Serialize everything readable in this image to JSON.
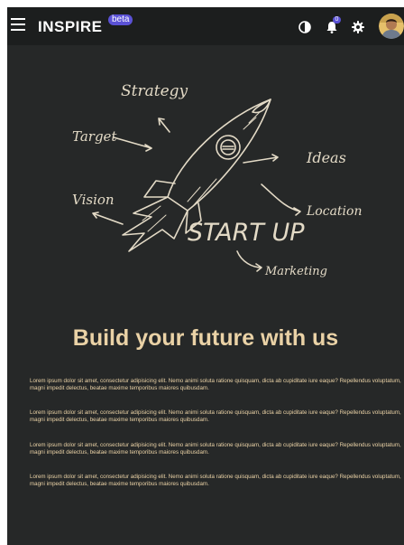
{
  "header": {
    "brand": "INSPIRE",
    "badge": "beta",
    "notification_count": "0"
  },
  "hero": {
    "art_labels": {
      "strategy": "Strategy",
      "target": "Target",
      "vision": "Vision",
      "ideas": "Ideas",
      "location": "Location",
      "startup": "START UP",
      "marketing": "Marketing"
    },
    "title": "Build your future with us"
  },
  "paragraphs": [
    "Lorem ipsum dolor sit amet, consectetur adipisicing elit. Nemo animi soluta ratione quisquam, dicta ab cupiditate iure eaque? Repellendus voluptatum, magni impedit delectus, beatae maxime temporibus maiores quibusdam.",
    "Lorem ipsum dolor sit amet, consectetur adipisicing elit. Nemo animi soluta ratione quisquam, dicta ab cupiditate iure eaque? Repellendus voluptatum, magni impedit delectus, beatae maxime temporibus maiores quibusdam.",
    "Lorem ipsum dolor sit amet, consectetur adipisicing elit. Nemo animi soluta ratione quisquam, dicta ab cupiditate iure eaque? Repellendus voluptatum, magni impedit delectus, beatae maxime temporibus maiores quibusdam.",
    "Lorem ipsum dolor sit amet, consectetur adipisicing elit. Nemo animi soluta ratione quisquam, dicta ab cupiditate iure eaque? Repellendus voluptatum, magni impedit delectus, beatae maxime temporibus maiores quibusdam."
  ],
  "colors": {
    "background": "#262828",
    "header_bg": "#1c1e1e",
    "accent_text": "#ead2a6",
    "badge_bg": "#5b52d6",
    "sketch": "#e3dac6"
  },
  "icons": {
    "menu": "hamburger-menu-icon",
    "theme": "contrast-icon",
    "notifications": "bell-icon",
    "settings": "gear-icon"
  }
}
